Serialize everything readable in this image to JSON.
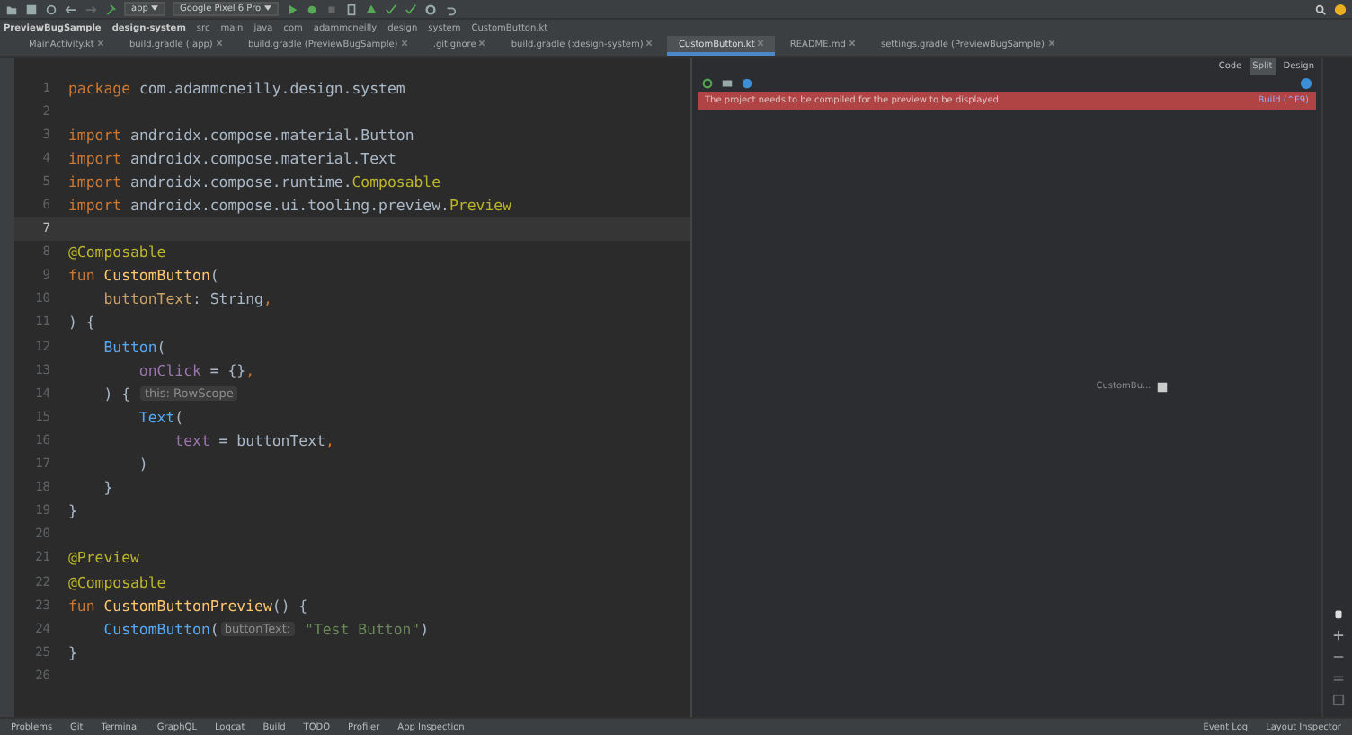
{
  "toolbar": {
    "config": "app",
    "device": "Google Pixel 6 Pro"
  },
  "breadcrumbs": [
    "PreviewBugSample",
    "design-system",
    "src",
    "main",
    "java",
    "com",
    "adammcneilly",
    "design",
    "system",
    "CustomButton.kt"
  ],
  "tabs": [
    {
      "label": "MainActivity.kt",
      "selected": false
    },
    {
      "label": "build.gradle (:app)",
      "selected": false
    },
    {
      "label": "build.gradle (PreviewBugSample)",
      "selected": false
    },
    {
      "label": ".gitignore",
      "selected": false
    },
    {
      "label": "build.gradle (:design-system)",
      "selected": false
    },
    {
      "label": "CustomButton.kt",
      "selected": true
    },
    {
      "label": "README.md",
      "selected": false
    },
    {
      "label": "settings.gradle (PreviewBugSample)",
      "selected": false
    }
  ],
  "editor": {
    "lines": [
      {
        "number": "1",
        "current": false,
        "tokens": [
          {
            "t": "package ",
            "kind": "kw"
          },
          {
            "t": "com.adammcneilly.design.system",
            "kind": "plain"
          }
        ]
      },
      {
        "number": "2",
        "current": false
      },
      {
        "number": "3",
        "current": false,
        "tokens": [
          {
            "t": "import ",
            "kind": "kw"
          },
          {
            "t": "androidx.compose.material.Button",
            "kind": "plain"
          }
        ]
      },
      {
        "number": "4",
        "current": false,
        "tokens": [
          {
            "t": "import ",
            "kind": "kw"
          },
          {
            "t": "androidx.compose.material.Text",
            "kind": "plain"
          }
        ]
      },
      {
        "number": "5",
        "current": false,
        "tokens": [
          {
            "t": "import ",
            "kind": "kw"
          },
          {
            "t": "androidx.compose.runtime.",
            "kind": "plain"
          },
          {
            "t": "Composable",
            "kind": "ann"
          }
        ]
      },
      {
        "number": "6",
        "current": false,
        "tokens": [
          {
            "t": "import ",
            "kind": "kw"
          },
          {
            "t": "androidx.compose.ui.tooling.preview.",
            "kind": "plain"
          },
          {
            "t": "Preview",
            "kind": "ann"
          }
        ]
      },
      {
        "number": "7",
        "current": true
      },
      {
        "number": "8",
        "current": false,
        "tokens": [
          {
            "t": "@Composable",
            "kind": "ann"
          }
        ]
      },
      {
        "number": "9",
        "current": false,
        "tokens": [
          {
            "t": "fun ",
            "kind": "kw"
          },
          {
            "t": "CustomButton",
            "kind": "fn"
          },
          {
            "t": "(",
            "kind": "plain"
          }
        ]
      },
      {
        "number": "10",
        "current": false,
        "tokens": [
          {
            "t": "    buttonText",
            "kind": "param"
          },
          {
            "t": ": String",
            "kind": "plain"
          },
          {
            "t": ",",
            "kind": "kw"
          }
        ]
      },
      {
        "number": "11",
        "current": false,
        "tokens": [
          {
            "t": ") {",
            "kind": "plain"
          }
        ]
      },
      {
        "number": "12",
        "current": false,
        "tokens": [
          {
            "t": "    Button",
            "kind": "call"
          },
          {
            "t": "(",
            "kind": "plain"
          }
        ]
      },
      {
        "number": "13",
        "current": false,
        "tokens": [
          {
            "t": "        onClick",
            "kind": "named"
          },
          {
            "t": " = {}",
            "kind": "plain"
          },
          {
            "t": ",",
            "kind": "kw"
          }
        ]
      },
      {
        "number": "14",
        "current": false,
        "tokens": [
          {
            "t": "    ) { ",
            "kind": "plain"
          },
          {
            "t": "this: RowScope",
            "kind": "hint"
          }
        ]
      },
      {
        "number": "15",
        "current": false,
        "tokens": [
          {
            "t": "        Text",
            "kind": "call"
          },
          {
            "t": "(",
            "kind": "plain"
          }
        ]
      },
      {
        "number": "16",
        "current": false,
        "tokens": [
          {
            "t": "            text",
            "kind": "named"
          },
          {
            "t": " = buttonText",
            "kind": "plain"
          },
          {
            "t": ",",
            "kind": "kw"
          }
        ]
      },
      {
        "number": "17",
        "current": false,
        "tokens": [
          {
            "t": "        )",
            "kind": "plain"
          }
        ]
      },
      {
        "number": "18",
        "current": false,
        "tokens": [
          {
            "t": "    }",
            "kind": "plain"
          }
        ]
      },
      {
        "number": "19",
        "current": false,
        "tokens": [
          {
            "t": "}",
            "kind": "plain"
          }
        ]
      },
      {
        "number": "20",
        "current": false
      },
      {
        "number": "21",
        "current": false,
        "tokens": [
          {
            "t": "@Preview",
            "kind": "ann"
          }
        ]
      },
      {
        "number": "22",
        "current": false,
        "tokens": [
          {
            "t": "@Composable",
            "kind": "ann"
          }
        ]
      },
      {
        "number": "23",
        "current": false,
        "tokens": [
          {
            "t": "fun ",
            "kind": "kw"
          },
          {
            "t": "CustomButtonPreview",
            "kind": "fn"
          },
          {
            "t": "() {",
            "kind": "plain"
          }
        ]
      },
      {
        "number": "24",
        "current": false,
        "tokens": [
          {
            "t": "    CustomButton",
            "kind": "call"
          },
          {
            "t": "(",
            "kind": "plain"
          },
          {
            "t": "buttonText:",
            "kind": "hint"
          },
          {
            "t": " \"Test Button\"",
            "kind": "str"
          },
          {
            "t": ")",
            "kind": "plain"
          }
        ]
      },
      {
        "number": "25",
        "current": false,
        "tokens": [
          {
            "t": "}",
            "kind": "plain"
          }
        ]
      },
      {
        "number": "26",
        "current": false
      }
    ]
  },
  "preview": {
    "modes": [
      {
        "label": "Code",
        "selected": false
      },
      {
        "label": "Split",
        "selected": true
      },
      {
        "label": "Design",
        "selected": false
      }
    ],
    "banner": {
      "message": "The project needs to be compiled for the preview to be displayed",
      "action": "Build (⌃F9)"
    },
    "component_label": "CustomBu..."
  },
  "bottom_tools": [
    "Problems",
    "Git",
    "Terminal",
    "GraphQL",
    "Logcat",
    "Build",
    "TODO",
    "Profiler",
    "App Inspection"
  ],
  "bottom_right_tools": [
    "Event Log",
    "Layout Inspector"
  ]
}
